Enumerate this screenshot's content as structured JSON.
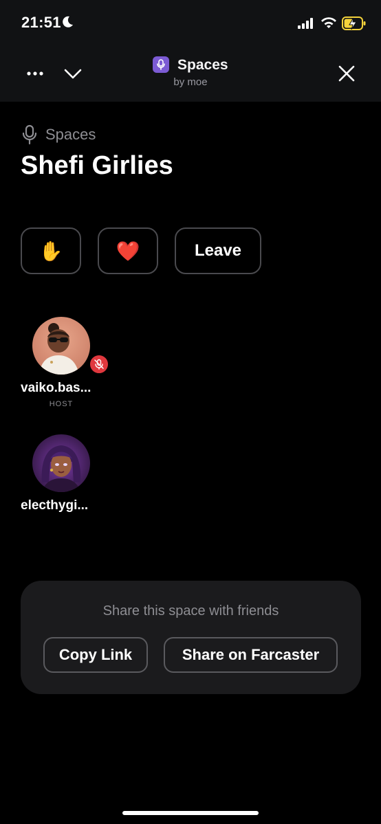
{
  "status_bar": {
    "time": "21:51",
    "icons": [
      "moon-icon",
      "signal-icon",
      "wifi-icon",
      "battery-charging-icon"
    ]
  },
  "header": {
    "app_name": "Spaces",
    "app_byline": "by moe",
    "icons": [
      "more-icon",
      "chevron-down-icon",
      "mic-icon",
      "close-icon"
    ]
  },
  "space": {
    "section_label": "Spaces",
    "title": "Shefi Girlies"
  },
  "actions": {
    "raise_hand": "✋",
    "heart": "❤️",
    "leave": "Leave"
  },
  "participants": [
    {
      "name": "vaiko.bas...",
      "role": "HOST",
      "muted": true
    },
    {
      "name": "electhygi...",
      "role": "",
      "muted": false
    }
  ],
  "share": {
    "prompt": "Share this space with friends",
    "copy_link": "Copy Link",
    "share_farcaster": "Share on Farcaster"
  },
  "colors": {
    "accent": "#7c5bd4",
    "muted_badge": "#e0383e",
    "background": "#000000",
    "header_bg": "#111214",
    "card_bg": "#1b1b1d",
    "battery_charging": "#f5d33b"
  }
}
